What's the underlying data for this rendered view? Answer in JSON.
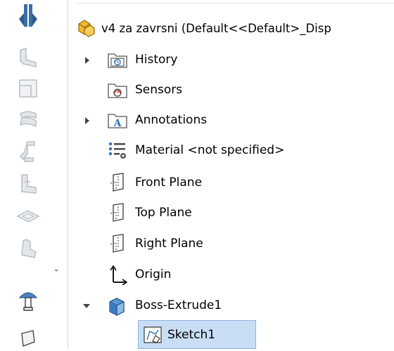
{
  "tree": {
    "root": {
      "label": "v4 za zavrsni  (Default<<Default>_Disp",
      "icon": "part-icon"
    },
    "items": [
      {
        "label": "History",
        "icon": "history-folder-icon",
        "expandable": true,
        "expanded": false
      },
      {
        "label": "Sensors",
        "icon": "sensors-folder-icon",
        "expandable": false
      },
      {
        "label": "Annotations",
        "icon": "annotations-folder-icon",
        "expandable": true,
        "expanded": false
      },
      {
        "label": "Material <not specified>",
        "icon": "material-icon",
        "expandable": false
      },
      {
        "label": "Front Plane",
        "icon": "plane-icon",
        "expandable": false
      },
      {
        "label": "Top Plane",
        "icon": "plane-icon",
        "expandable": false
      },
      {
        "label": "Right Plane",
        "icon": "plane-icon",
        "expandable": false
      },
      {
        "label": "Origin",
        "icon": "origin-icon",
        "expandable": false
      },
      {
        "label": "Boss-Extrude1",
        "icon": "extrude-icon",
        "expandable": true,
        "expanded": true
      },
      {
        "label": "Sketch1",
        "icon": "sketch-icon",
        "expandable": false,
        "selected": true
      }
    ]
  },
  "toolbar": {
    "buttons": [
      "feature-manager-icon",
      "sheet-metal-base-flange-icon",
      "sheet-metal-corner-icon",
      "sheet-metal-hem-icon",
      "sheet-metal-jog-icon",
      "sheet-metal-bracket-icon",
      "sheet-metal-flat-icon",
      "sheet-metal-forming-tool-icon",
      "sheet-metal-gusset-icon",
      "sheet-metal-extra-icon"
    ]
  },
  "colors": {
    "selection_bg": "#c9def5",
    "selection_border": "#8db2e0",
    "toolbar_icon_gray": "#b9bfc5",
    "accent_blue": "#2f6fb3",
    "part_yellow": "#e6a817"
  }
}
